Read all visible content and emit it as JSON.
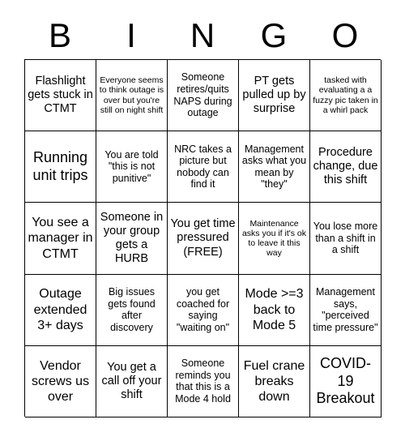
{
  "card": {
    "header_letters": [
      "B",
      "I",
      "N",
      "G",
      "O"
    ],
    "grid": {
      "rows": 5,
      "columns": 5,
      "border_color": "#000000",
      "background_color": "#ffffff",
      "text_color": "#000000"
    },
    "cells": [
      [
        "Flashlight gets stuck in CTMT",
        "Everyone seems to think outage is over but you're still on night shift",
        "Someone retires/quits NAPS during outage",
        "PT gets pulled up by surprise",
        "tasked with evaluating a a fuzzy pic taken in a whirl pack"
      ],
      [
        "Running unit trips",
        "You are told \"this is not punitive\"",
        "NRC takes a picture but nobody can find it",
        "Management asks what you mean by \"they\"",
        "Procedure change, due this shift"
      ],
      [
        "You see a manager in CTMT",
        "Someone in your group gets a HURB",
        "You get time pressured (FREE)",
        "Maintenance asks you if it's ok to leave it this way",
        "You lose more than a shift in a shift"
      ],
      [
        "Outage extended 3+ days",
        "Big issues gets found after discovery",
        "you get coached for saying \"waiting on\"",
        "Mode >=3 back to Mode 5",
        "Management says, \"perceived time pressure\""
      ],
      [
        "Vendor screws us over",
        "You get a call off your shift",
        "Someone reminds you that this is a Mode 4 hold",
        "Fuel crane breaks down",
        "COVID-19 Breakout"
      ]
    ]
  }
}
